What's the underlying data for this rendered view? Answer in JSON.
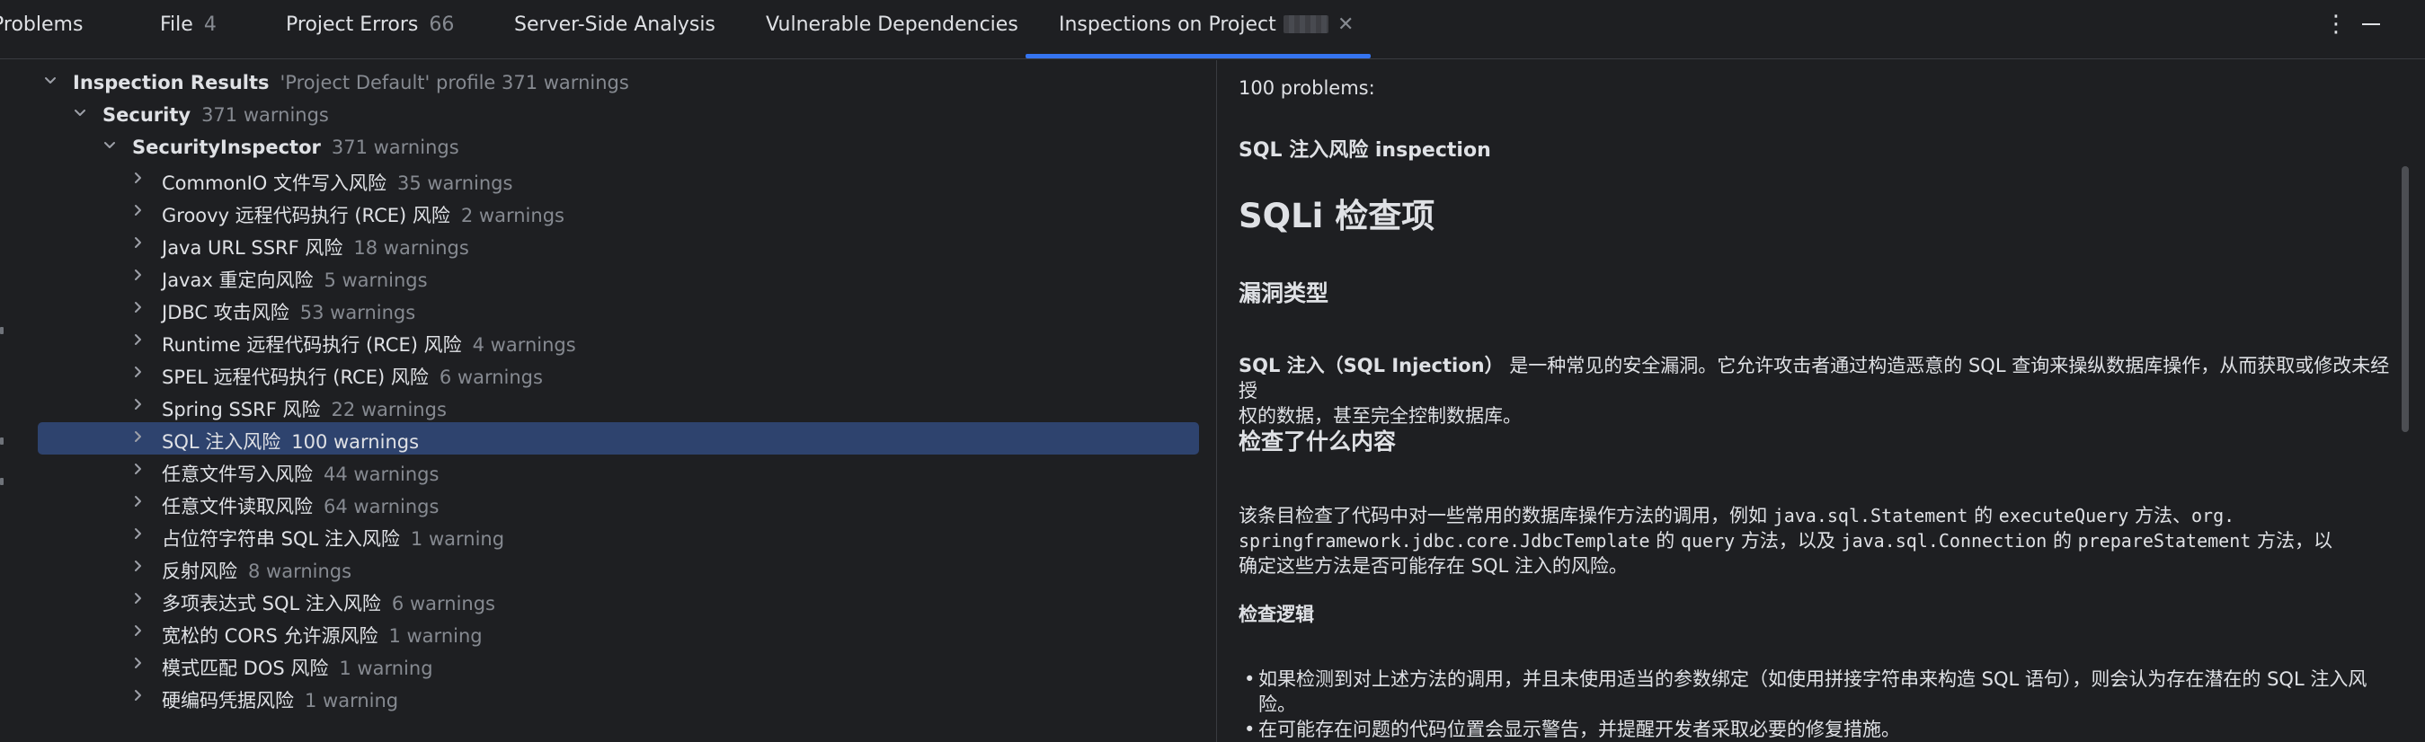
{
  "tabbar": {
    "title": "Problems",
    "tabs": [
      {
        "label": "File",
        "count": "4"
      },
      {
        "label": "Project Errors",
        "count": "66"
      },
      {
        "label": "Server-Side Analysis",
        "count": ""
      },
      {
        "label": "Vulnerable Dependencies",
        "count": ""
      },
      {
        "label": "Inspections on Project",
        "count": ""
      }
    ],
    "close_glyph": "✕",
    "more_glyph": "⋮",
    "minimize_icon": "minimize-icon",
    "accent_color": "#3574f0"
  },
  "tree": {
    "root": {
      "label": "Inspection Results",
      "meta": "'Project Default' profile  371 warnings"
    },
    "group": {
      "label": "Security",
      "meta": "371 warnings"
    },
    "inspector": {
      "label": "SecurityInspector",
      "meta": "371 warnings"
    },
    "items": [
      {
        "label": "CommonIO 文件写入风险",
        "meta": "35 warnings"
      },
      {
        "label": "Groovy 远程代码执行 (RCE) 风险",
        "meta": "2 warnings"
      },
      {
        "label": "Java URL SSRF 风险",
        "meta": "18 warnings"
      },
      {
        "label": "Javax 重定向风险",
        "meta": "5 warnings"
      },
      {
        "label": "JDBC 攻击风险",
        "meta": "53 warnings"
      },
      {
        "label": "Runtime 远程代码执行 (RCE) 风险",
        "meta": "4 warnings"
      },
      {
        "label": "SPEL 远程代码执行 (RCE) 风险",
        "meta": "6 warnings"
      },
      {
        "label": "Spring SSRF 风险",
        "meta": "22 warnings"
      },
      {
        "label": "SQL 注入风险",
        "meta": "100 warnings"
      },
      {
        "label": "任意文件写入风险",
        "meta": "44 warnings"
      },
      {
        "label": "任意文件读取风险",
        "meta": "64 warnings"
      },
      {
        "label": "占位符字符串 SQL 注入风险",
        "meta": "1 warning"
      },
      {
        "label": "反射风险",
        "meta": "8 warnings"
      },
      {
        "label": "多项表达式 SQL 注入风险",
        "meta": "6 warnings"
      },
      {
        "label": "宽松的 CORS 允许源风险",
        "meta": "1 warning"
      },
      {
        "label": "模式匹配 DOS 风险",
        "meta": "1 warning"
      },
      {
        "label": "硬编码凭据风险",
        "meta": "1 warning"
      }
    ],
    "selected_index": 8,
    "selection_color": "#2e436e"
  },
  "description": {
    "count": "100 problems:",
    "inspection": "SQL 注入风险 inspection",
    "h1": "SQLi 检查项",
    "vuln_type_heading": "漏洞类型",
    "vuln_intro_bold": "SQL 注入（SQL Injection）",
    "vuln_intro_rest": " 是一种常见的安全漏洞。它允许攻击者通过构造恶意的 SQL 查询来操纵数据库操作，从而获取或修改未经授",
    "vuln_intro_line2": "权的数据，甚至完全控制数据库。",
    "what_heading": "检查了什么内容",
    "what_p1_a": "该条目检查了代码中对一些常用的数据库操作方法的调用，例如 ",
    "what_code1": "java.sql.Statement",
    "what_p1_b": " 的 ",
    "what_code2": "executeQuery",
    "what_p1_c": " 方法、",
    "what_code3a": "org.",
    "what_code3b": "springframework.jdbc.core.JdbcTemplate",
    "what_p2_a": " 的 ",
    "what_code4": "query",
    "what_p2_b": " 方法，以及 ",
    "what_code5": "java.sql.Connection",
    "what_p2_c": " 的 ",
    "what_code6": "prepareStatement",
    "what_p2_d": " 方法，以",
    "what_line3": "确定这些方法是否可能存在 SQL 注入的风险。",
    "logic_heading": "检查逻辑",
    "bullets": [
      {
        "line1": "如果检测到对上述方法的调用，并且未使用适当的参数绑定（如使用拼接字符串来构造 SQL 语句），则会认为存在潜在的 SQL 注入风",
        "line2": "险。"
      },
      {
        "line1": "在可能存在问题的代码位置会显示警告，并提醒开发者采取必要的修复措施。",
        "line2": ""
      }
    ],
    "bullet_glyph": "•"
  }
}
